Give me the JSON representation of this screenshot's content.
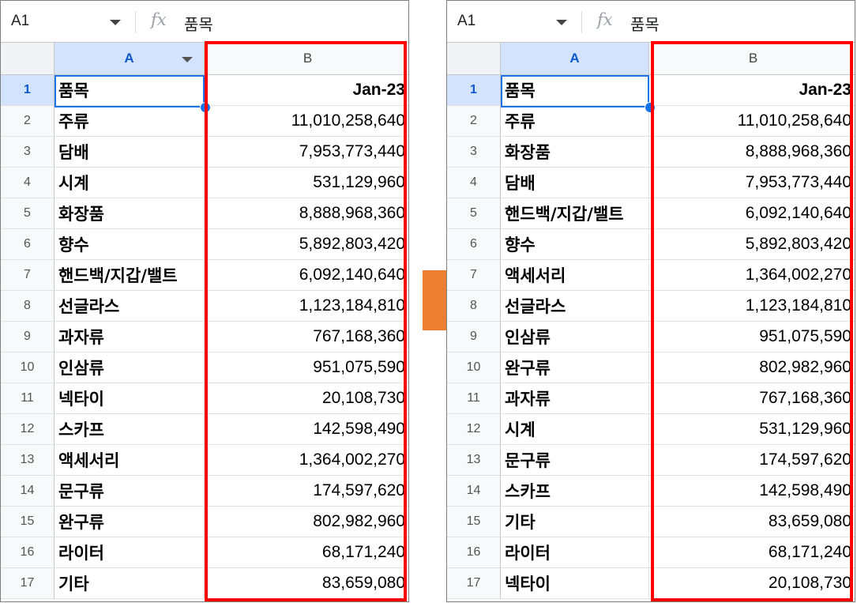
{
  "panels": [
    {
      "name_box": "A1",
      "formula_icon": "fx",
      "formula_content": "품목",
      "column_headers": [
        "A",
        "B"
      ],
      "rows": [
        {
          "num": "1",
          "a": "품목",
          "b": "Jan-23"
        },
        {
          "num": "2",
          "a": "주류",
          "b": "11,010,258,640"
        },
        {
          "num": "3",
          "a": "담배",
          "b": "7,953,773,440"
        },
        {
          "num": "4",
          "a": "시계",
          "b": "531,129,960"
        },
        {
          "num": "5",
          "a": "화장품",
          "b": "8,888,968,360"
        },
        {
          "num": "6",
          "a": "향수",
          "b": "5,892,803,420"
        },
        {
          "num": "7",
          "a": "핸드백/지갑/밸트",
          "b": "6,092,140,640"
        },
        {
          "num": "8",
          "a": "선글라스",
          "b": "1,123,184,810"
        },
        {
          "num": "9",
          "a": "과자류",
          "b": "767,168,360"
        },
        {
          "num": "10",
          "a": "인삼류",
          "b": "951,075,590"
        },
        {
          "num": "11",
          "a": "넥타이",
          "b": "20,108,730"
        },
        {
          "num": "12",
          "a": "스카프",
          "b": "142,598,490"
        },
        {
          "num": "13",
          "a": "액세서리",
          "b": "1,364,002,270"
        },
        {
          "num": "14",
          "a": "문구류",
          "b": "174,597,620"
        },
        {
          "num": "15",
          "a": "완구류",
          "b": "802,982,960"
        },
        {
          "num": "16",
          "a": "라이터",
          "b": "68,171,240"
        },
        {
          "num": "17",
          "a": "기타",
          "b": "83,659,080"
        }
      ]
    },
    {
      "name_box": "A1",
      "formula_icon": "fx",
      "formula_content": "품목",
      "column_headers": [
        "A",
        "B"
      ],
      "rows": [
        {
          "num": "1",
          "a": "품목",
          "b": "Jan-23"
        },
        {
          "num": "2",
          "a": "주류",
          "b": "11,010,258,640"
        },
        {
          "num": "3",
          "a": "화장품",
          "b": "8,888,968,360"
        },
        {
          "num": "4",
          "a": "담배",
          "b": "7,953,773,440"
        },
        {
          "num": "5",
          "a": "핸드백/지갑/밸트",
          "b": "6,092,140,640"
        },
        {
          "num": "6",
          "a": "향수",
          "b": "5,892,803,420"
        },
        {
          "num": "7",
          "a": "액세서리",
          "b": "1,364,002,270"
        },
        {
          "num": "8",
          "a": "선글라스",
          "b": "1,123,184,810"
        },
        {
          "num": "9",
          "a": "인삼류",
          "b": "951,075,590"
        },
        {
          "num": "10",
          "a": "완구류",
          "b": "802,982,960"
        },
        {
          "num": "11",
          "a": "과자류",
          "b": "767,168,360"
        },
        {
          "num": "12",
          "a": "시계",
          "b": "531,129,960"
        },
        {
          "num": "13",
          "a": "문구류",
          "b": "174,597,620"
        },
        {
          "num": "14",
          "a": "스카프",
          "b": "142,598,490"
        },
        {
          "num": "15",
          "a": "기타",
          "b": "83,659,080"
        },
        {
          "num": "16",
          "a": "라이터",
          "b": "68,171,240"
        },
        {
          "num": "17",
          "a": "넥타이",
          "b": "20,108,730"
        }
      ]
    }
  ],
  "colors": {
    "highlight": "#ff0000",
    "arrow": "#ed7d31",
    "selection": "#1a73e8",
    "selected_header_bg": "#d3e3fd"
  },
  "icons": {
    "name_box_dropdown": "chevron-down-icon",
    "formula": "fx-icon",
    "column_menu": "column-menu-icon",
    "transition": "right-arrow-icon"
  }
}
